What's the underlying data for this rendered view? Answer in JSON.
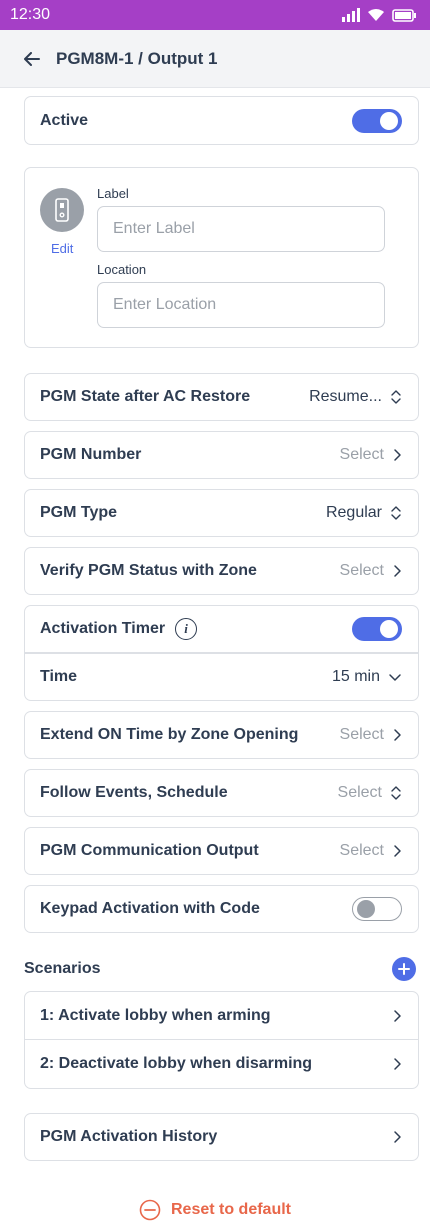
{
  "status": {
    "time": "12:30"
  },
  "header": {
    "title": "PGM8M-1 / Output 1"
  },
  "active": {
    "label": "Active",
    "on": true
  },
  "identity": {
    "edit": "Edit",
    "label_title": "Label",
    "label_placeholder": "Enter Label",
    "location_title": "Location",
    "location_placeholder": "Enter Location"
  },
  "rows": {
    "ac_restore": {
      "label": "PGM State after AC Restore",
      "value": "Resume..."
    },
    "pgm_number": {
      "label": "PGM Number",
      "value": "Select"
    },
    "pgm_type": {
      "label": "PGM Type",
      "value": "Regular"
    },
    "verify": {
      "label": "Verify PGM Status with Zone",
      "value": "Select"
    },
    "activation_timer": {
      "label": "Activation Timer",
      "on": true
    },
    "time": {
      "label": "Time",
      "value": "15 min"
    },
    "extend_on": {
      "label": "Extend ON Time by Zone Opening",
      "value": "Select"
    },
    "follow_events": {
      "label": "Follow Events, Schedule",
      "value": "Select"
    },
    "comm_output": {
      "label": "PGM Communication Output",
      "value": "Select"
    },
    "keypad": {
      "label": "Keypad Activation with Code",
      "on": false
    }
  },
  "scenarios": {
    "title": "Scenarios",
    "items": [
      {
        "label": "1: Activate lobby when arming"
      },
      {
        "label": "2: Deactivate lobby when disarming"
      }
    ]
  },
  "history": {
    "label": "PGM Activation History"
  },
  "reset": {
    "label": "Reset to default"
  },
  "colors": {
    "status_bar": "#a53fc6",
    "accent": "#4f6de6",
    "danger": "#e8674a",
    "text": "#2f3d52",
    "muted": "#9aa0a8"
  }
}
